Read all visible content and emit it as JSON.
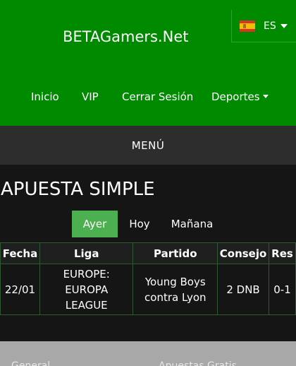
{
  "header": {
    "title": "BETAGamers.Net",
    "language": {
      "label": "ES",
      "flag_icon": "spain-flag-icon"
    }
  },
  "nav": {
    "items": [
      {
        "label": "Inicio"
      },
      {
        "label": "VIP"
      },
      {
        "label": "Cerrar Sesión"
      },
      {
        "label": "Deportes"
      }
    ]
  },
  "menu": {
    "label": "MENÚ"
  },
  "main": {
    "title": "APUESTA SIMPLE",
    "tabs": [
      {
        "label": "Ayer",
        "active": true
      },
      {
        "label": "Hoy",
        "active": false
      },
      {
        "label": "Mañana",
        "active": false
      }
    ],
    "table": {
      "headers": [
        "Fecha",
        "Liga",
        "Partido",
        "Consejo",
        "Res"
      ],
      "rows": [
        {
          "fecha": "22/01",
          "liga": [
            "EUROPE:",
            "EUROPA",
            "LEAGUE"
          ],
          "partido": [
            "Young Boys",
            "contra Lyon"
          ],
          "consejo": "2 DNB",
          "res": "0-1"
        }
      ]
    }
  },
  "footer": {
    "links": [
      "General",
      "Apuestas Gratis"
    ]
  },
  "colors": {
    "header_bg": "#008a00",
    "active_tab": "#4caf50",
    "menu_bar": "#2d2d2d",
    "page_bg": "#151515",
    "footer_bg": "#a8a8a8"
  }
}
